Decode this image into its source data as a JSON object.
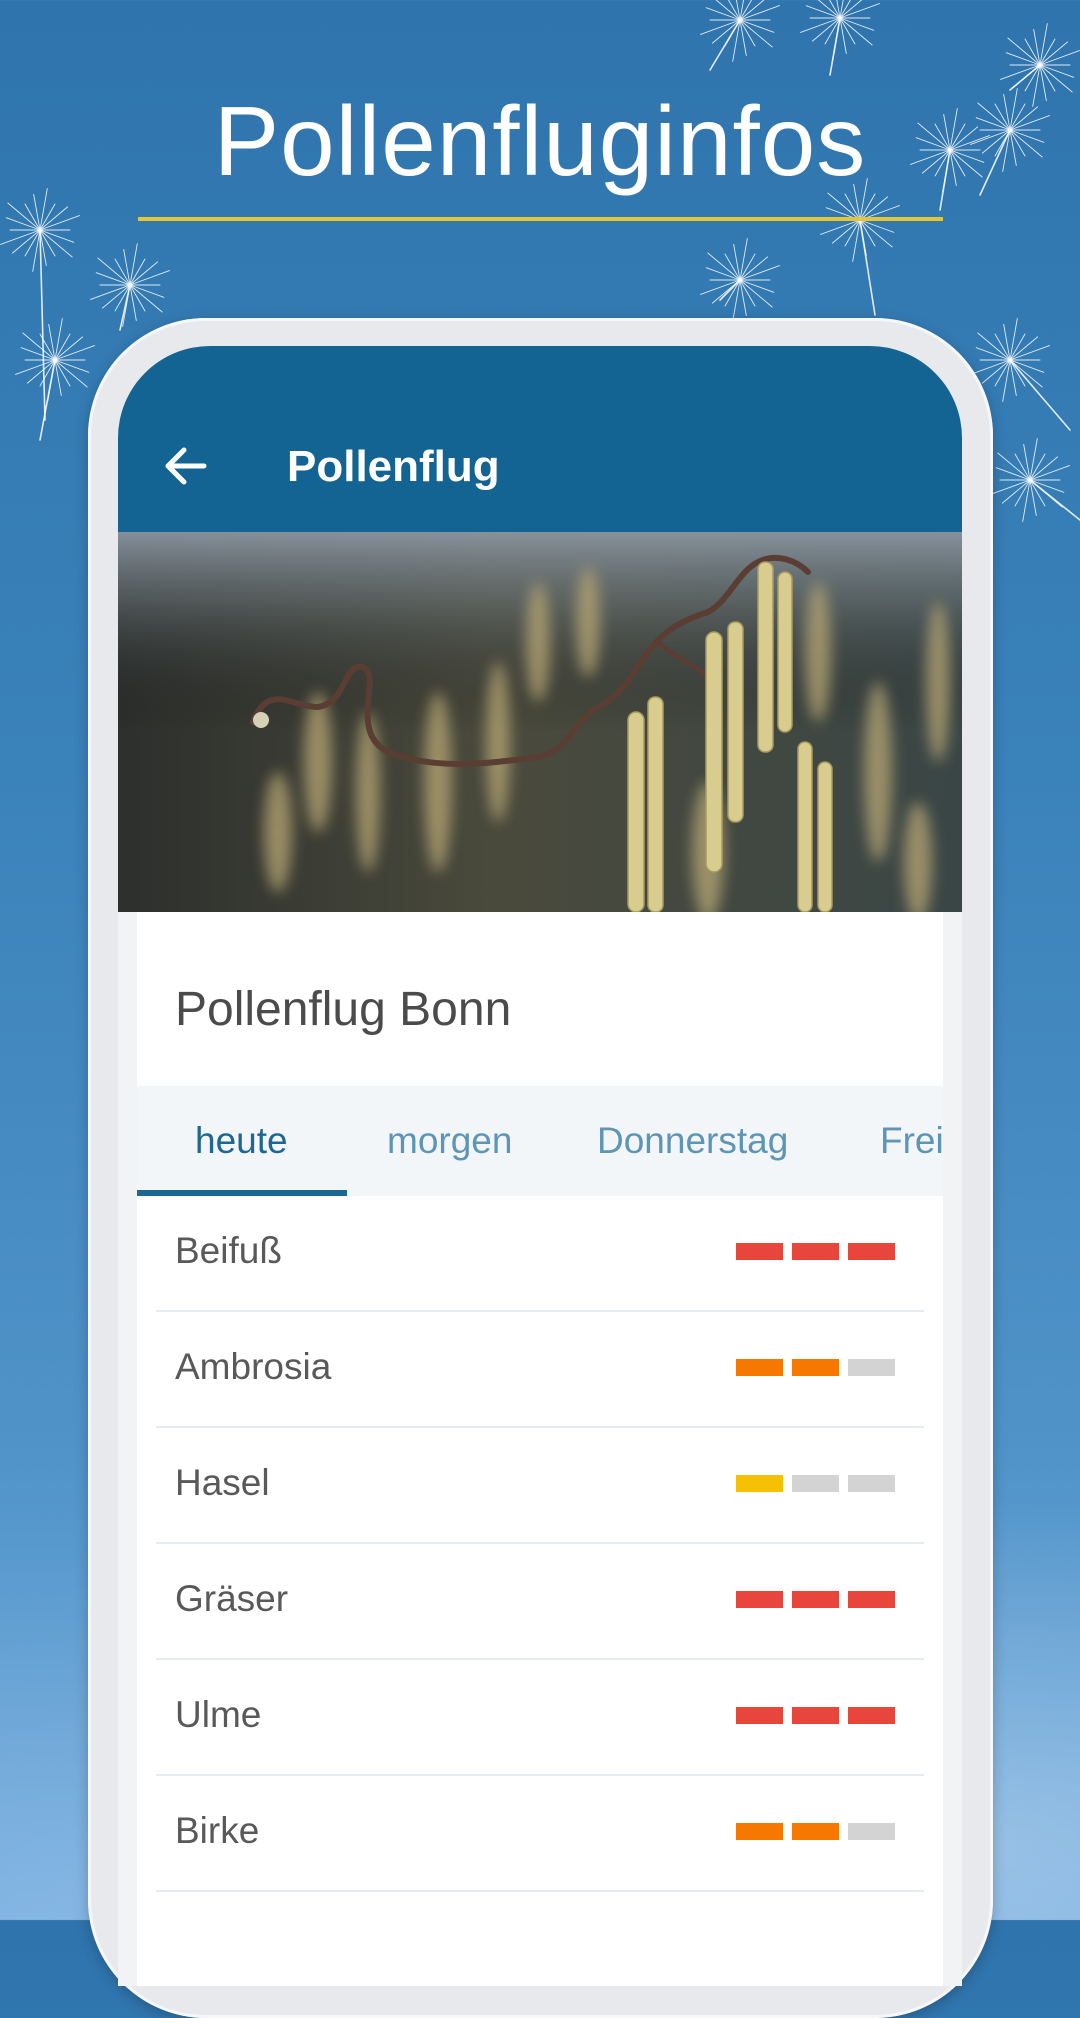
{
  "promo": {
    "title": "Pollenfluginfos"
  },
  "colors": {
    "level_high": "#e8453c",
    "level_medium": "#f77800",
    "level_low": "#f6c104",
    "level_none": "#d3d3d3",
    "appbar": "#136393",
    "accent_line": "#e3c631"
  },
  "appbar": {
    "back_icon": "arrow-left-icon",
    "title": "Pollenflug"
  },
  "hero": {
    "subject": "hazel catkins photo"
  },
  "card": {
    "title": "Pollenflug Bonn"
  },
  "tabs": [
    {
      "label": "heute",
      "active": true
    },
    {
      "label": "morgen",
      "active": false
    },
    {
      "label": "Donnerstag",
      "active": false
    },
    {
      "label": "Freitag",
      "active": false
    }
  ],
  "pollen": [
    {
      "name": "Beifuß",
      "levels": [
        "high",
        "high",
        "high"
      ]
    },
    {
      "name": "Ambrosia",
      "levels": [
        "medium",
        "medium",
        "none"
      ]
    },
    {
      "name": "Hasel",
      "levels": [
        "low",
        "none",
        "none"
      ]
    },
    {
      "name": "Gräser",
      "levels": [
        "high",
        "high",
        "high"
      ]
    },
    {
      "name": "Ulme",
      "levels": [
        "high",
        "high",
        "high"
      ]
    },
    {
      "name": "Birke",
      "levels": [
        "medium",
        "medium",
        "none"
      ]
    }
  ]
}
